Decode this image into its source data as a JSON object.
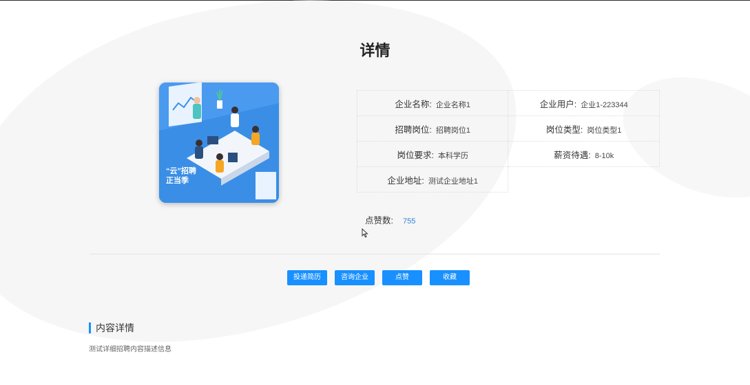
{
  "page": {
    "title": "详情"
  },
  "cover": {
    "badge_line1": "“云”招聘",
    "badge_line2": "正当季"
  },
  "info": {
    "rows": [
      [
        {
          "label": "企业名称:",
          "value": "企业名称1"
        },
        {
          "label": "企业用户:",
          "value": "企业1-223344"
        }
      ],
      [
        {
          "label": "招聘岗位:",
          "value": "招聘岗位1"
        },
        {
          "label": "岗位类型:",
          "value": "岗位类型1"
        }
      ],
      [
        {
          "label": "岗位要求:",
          "value": "本科学历"
        },
        {
          "label": "薪资待遇:",
          "value": "8-10k"
        }
      ],
      [
        {
          "label": "企业地址:",
          "value": "测试企业地址1"
        },
        {
          "label": "",
          "value": ""
        }
      ]
    ]
  },
  "likes": {
    "label": "点赞数:",
    "count": "755"
  },
  "actions": {
    "resume": "投递简历",
    "consult": "咨询企业",
    "like": "点赞",
    "favorite": "收藏"
  },
  "content": {
    "heading": "内容详情",
    "text": "测试详细招聘内容描述信息"
  },
  "colors": {
    "accent": "#1890ff",
    "link": "#2f82d6"
  }
}
